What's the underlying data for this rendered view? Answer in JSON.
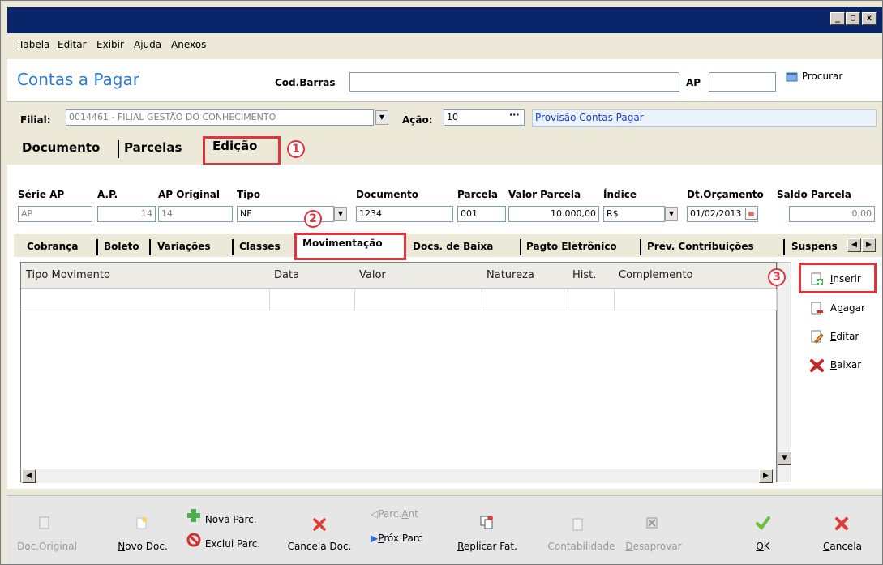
{
  "window": {
    "controls": {
      "minimize": "_",
      "maximize": "□",
      "close": "x"
    }
  },
  "menu": {
    "items": [
      {
        "label": "Tabela",
        "underline": "T",
        "rest": "abela"
      },
      {
        "label": "Editar",
        "underline": "E",
        "rest": "ditar"
      },
      {
        "label": "Exibir",
        "pre": "E",
        "underline": "x",
        "rest": "ibir"
      },
      {
        "label": "Ajuda",
        "underline": "A",
        "rest": "juda"
      },
      {
        "label": "Anexos",
        "pre": "A",
        "underline": "n",
        "rest": "exos"
      }
    ]
  },
  "header": {
    "title": "Contas a Pagar",
    "cod_barras_label": "Cod.Barras",
    "cod_barras_value": "",
    "ap_label": "AP",
    "ap_value": "",
    "procurar_label": "Procurar"
  },
  "filial": {
    "label": "Filial:",
    "value": "0014461 - FILIAL GESTÃO DO CONHECIMENTO",
    "acao_label": "Ação:",
    "acao_value": "10",
    "ellipsis": "···",
    "acao_desc": "Provisão Contas Pagar"
  },
  "main_tabs": [
    {
      "label": "Documento",
      "active": false
    },
    {
      "label": "Parcelas",
      "active": false
    },
    {
      "label": "Edição",
      "active": true
    }
  ],
  "annotations": {
    "one": "1",
    "two": "2",
    "three": "3"
  },
  "form": {
    "serie_ap": {
      "label": "Série AP",
      "value": "AP"
    },
    "ap": {
      "label": "A.P.",
      "value": "14"
    },
    "ap_original": {
      "label": "AP Original",
      "value": "14"
    },
    "tipo": {
      "label": "Tipo",
      "value": "NF"
    },
    "documento": {
      "label": "Documento",
      "value": "1234"
    },
    "parcela": {
      "label": "Parcela",
      "value": "001"
    },
    "valor_parcela": {
      "label": "Valor Parcela",
      "value": "10.000,00"
    },
    "indice": {
      "label": "Índice",
      "value": "R$"
    },
    "dt_orcamento": {
      "label": "Dt.Orçamento",
      "value": "01/02/2013"
    },
    "saldo_parcela": {
      "label": "Saldo Parcela",
      "value": "0,00"
    }
  },
  "sub_tabs": [
    {
      "label": "Cobrança"
    },
    {
      "label": "Boleto"
    },
    {
      "label": "Variações"
    },
    {
      "label": "Classes"
    },
    {
      "label": "Movimentação",
      "active": true
    },
    {
      "label": "Docs. de Baixa"
    },
    {
      "label": "Pagto Eletrônico"
    },
    {
      "label": "Prev. Contribuições"
    },
    {
      "label": "Suspens"
    }
  ],
  "grid": {
    "columns": [
      "Tipo Movimento",
      "Data",
      "Valor",
      "Natureza",
      "Hist.",
      "Complemento"
    ],
    "rows": [
      [
        "",
        "",
        "",
        "",
        "",
        ""
      ]
    ]
  },
  "side_actions": {
    "inserir": {
      "underline": "I",
      "rest": "nserir"
    },
    "apagar": {
      "pre": "A",
      "underline": "p",
      "rest": "agar"
    },
    "editar": {
      "underline": "E",
      "rest": "ditar"
    },
    "baixar": {
      "underline": "B",
      "rest": "aixar"
    }
  },
  "toolbar": {
    "doc_original": "Doc.Original",
    "novo_doc": {
      "underline": "N",
      "rest": "ovo Doc."
    },
    "nova_parc": "Nova Parc.",
    "exclui_parc": "Exclui Parc.",
    "cancela_doc": "Cancela Doc.",
    "parc_ant": {
      "pre": "Parc.",
      "underline": "A",
      "rest": "nt"
    },
    "prox_parc": {
      "underline": "P",
      "rest": "róx Parc"
    },
    "replicar_fat": {
      "underline": "R",
      "rest": "eplicar Fat."
    },
    "contabilidade": "Contabilidade",
    "desaprovar": {
      "underline": "D",
      "rest": "esaprovar"
    },
    "ok": {
      "underline": "O",
      "rest": "K"
    },
    "cancela": {
      "underline": "C",
      "rest": "ancela"
    }
  },
  "colors": {
    "title_blue": "#2b7bd4",
    "titlebar": "#0a246a",
    "annotation_red": "#e0333c",
    "link_blue": "#1a3fd6"
  }
}
